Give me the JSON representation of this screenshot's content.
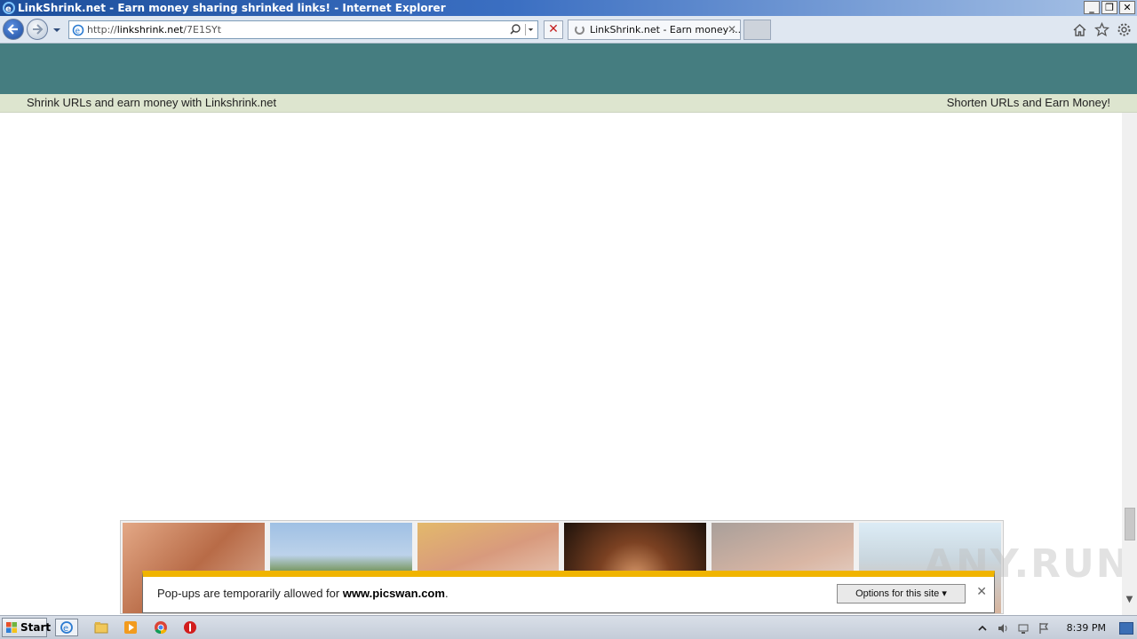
{
  "window": {
    "title": "LinkShrink.net - Earn money sharing shrinked links! - Internet Explorer",
    "minimize": "_",
    "restore": "❐",
    "close": "✕"
  },
  "navbar": {
    "url_scheme": "http://",
    "url_host": "linkshrink.net",
    "url_path": "/7E1SYt",
    "tab_title": "LinkShrink.net - Earn money ...",
    "tab_close": "✕",
    "stop": "✕"
  },
  "page": {
    "strip_left": "Shrink URLs and earn money with Linkshrink.net",
    "strip_right": "Shorten URLs and Earn Money!"
  },
  "notification": {
    "prefix": "Pop-ups are temporarily allowed for ",
    "site": "www.picswan.com",
    "suffix": ".",
    "options_label": "Options for this site ▾",
    "close": "✕"
  },
  "watermark": "ANY.RUN",
  "taskbar": {
    "start_label": "Start",
    "clock": "8:39 PM",
    "icons": [
      "ie-icon",
      "explorer-icon",
      "media-player-icon",
      "chrome-icon",
      "stop-icon"
    ]
  },
  "colors": {
    "header": "#457d80",
    "strip": "#dde5cf",
    "notify_accent": "#f0b400"
  }
}
